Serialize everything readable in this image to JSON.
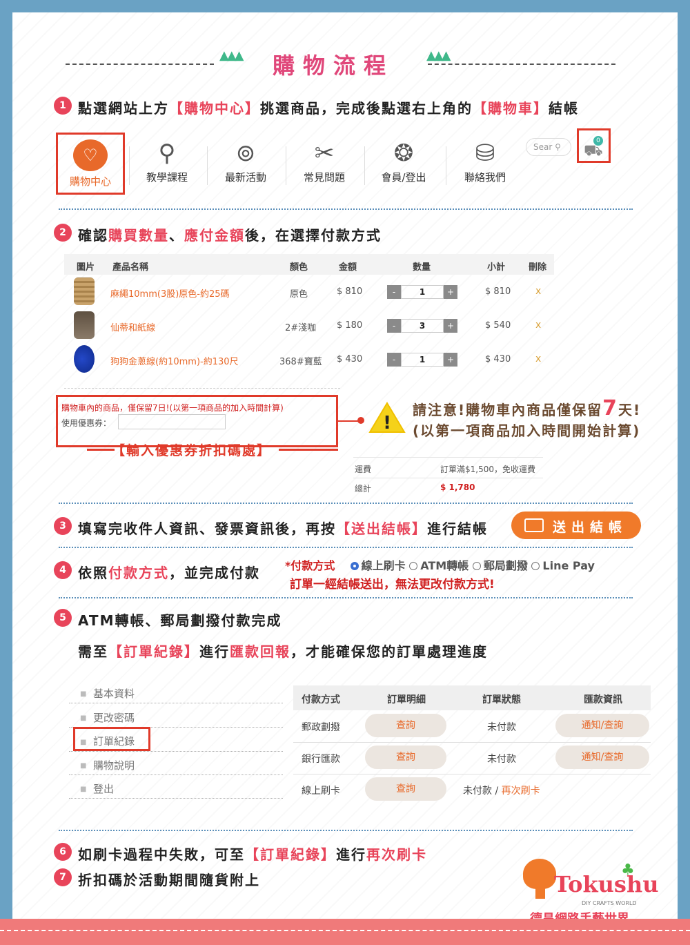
{
  "title": "購物流程",
  "steps": {
    "s1": {
      "num": "1",
      "a": "點選網站上方",
      "b": "【購物中心】",
      "c": "挑選商品，完成後點選右上角的",
      "d": "【購物車】",
      "e": "結帳"
    },
    "s2": {
      "num": "2",
      "a": "確認",
      "b": "購買數量",
      "c": "、",
      "d": "應付金額",
      "e": "後，在選擇付款方式"
    },
    "s3": {
      "num": "3",
      "a": "填寫完收件人資訊、發票資訊後，再按",
      "b": "【送出結帳】",
      "c": "進行結帳"
    },
    "s4": {
      "num": "4",
      "a": "依照",
      "b": "付款方式",
      "c": "，並完成付款"
    },
    "s5": {
      "num": "5",
      "a": "ATM轉帳、郵局劃撥付款完成"
    },
    "s5b": {
      "a": "需至",
      "b": "【訂單紀錄】",
      "c": "進行",
      "d": "匯款回報",
      "e": "，才能確保您的訂單處理進度"
    },
    "s6": {
      "num": "6",
      "a": "如刷卡過程中失敗，可至",
      "b": "【訂單紀錄】",
      "c": "進行",
      "d": "再次刷卡"
    },
    "s7": {
      "num": "7",
      "a": "折扣碼於活動期間隨貨附上"
    }
  },
  "nav": {
    "items": [
      "購物中心",
      "教學課程",
      "最新活動",
      "常見問題",
      "會員/登出",
      "聯絡我們"
    ],
    "search_placeholder": "Sear",
    "cart_count": "0"
  },
  "cart": {
    "headers": [
      "圖片",
      "產品名稱",
      "顏色",
      "金額",
      "數量",
      "小計",
      "刪除"
    ],
    "rows": [
      {
        "name": "麻繩10mm(3股)原色-約25碼",
        "color": "原色",
        "price": "$ 810",
        "qty": "1",
        "subtotal": "$ 810",
        "del": "x"
      },
      {
        "name": "仙蒂和紙線",
        "color": "2#淺咖",
        "price": "$ 180",
        "qty": "3",
        "subtotal": "$ 540",
        "del": "x"
      },
      {
        "name": "狗狗金蔥線(約10mm)-約130尺",
        "color": "368#寶藍",
        "price": "$ 430",
        "qty": "1",
        "subtotal": "$ 430",
        "del": "x"
      }
    ],
    "notice": "購物車內的商品，僅保留7日!(以第一項商品的加入時間計算)",
    "coupon_label": "使用優惠券：",
    "coupon_caption": "【輸入優惠券折扣碼處】",
    "shipping_label": "運費",
    "shipping_value": "訂單滿$1,500，免收運費",
    "total_label": "總計",
    "total_value": "$ 1,780"
  },
  "warning": {
    "line1a": "請注意!購物車內商品僅保留",
    "big": "7",
    "line1b": "天!",
    "line2": "(以第一項商品加入時間開始計算)"
  },
  "checkout_button": "送出結帳",
  "payment": {
    "label": "*付款方式",
    "options": [
      "線上刷卡",
      "ATM轉帳",
      "郵局劃撥",
      "Line Pay"
    ],
    "warning": "訂單一經結帳送出，無法更改付款方式!"
  },
  "member_menu": [
    "基本資料",
    "更改密碼",
    "訂單紀錄",
    "購物說明",
    "登出"
  ],
  "orders": {
    "headers": [
      "付款方式",
      "訂單明細",
      "訂單狀態",
      "匯款資訊"
    ],
    "rows": [
      {
        "method": "郵政劃撥",
        "detail": "查詢",
        "status": "未付款",
        "info": "通知/查詢"
      },
      {
        "method": "銀行匯款",
        "detail": "查詢",
        "status": "未付款",
        "info": "通知/查詢"
      },
      {
        "method": "線上刷卡",
        "detail": "查詢",
        "status": "未付款 / ",
        "status_link": "再次刷卡"
      }
    ]
  },
  "logo": {
    "brand": "Tokushu",
    "tagline": "DIY CRAFTS WORLD",
    "chinese": "德昌網路手藝世界"
  },
  "colors": {
    "accent": "#e8445a",
    "orange": "#e8692a",
    "blue_border": "#6aa2c4",
    "footer": "#f07a7a"
  }
}
